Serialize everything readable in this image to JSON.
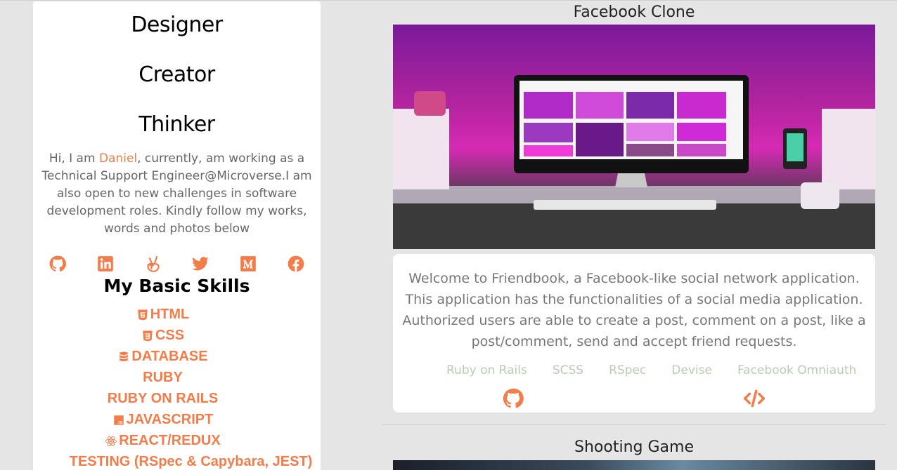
{
  "sidebar": {
    "headlines": [
      "Designer",
      "Creator",
      "Thinker"
    ],
    "bio": {
      "prefix": "Hi, I am ",
      "name": "Daniel",
      "suffix": ", currently, am working as a Technical Support Engineer@Microverse.I am also open to new challenges in software development roles. Kindly follow my works, words and photos below"
    },
    "socials": [
      "github-icon",
      "linkedin-icon",
      "angellist-icon",
      "twitter-icon",
      "medium-icon",
      "facebook-icon"
    ],
    "skills_title": "My Basic Skills",
    "skills": [
      {
        "label": "HTML",
        "icon": "html5-icon"
      },
      {
        "label": "CSS",
        "icon": "css3-icon"
      },
      {
        "label": "DATABASE",
        "icon": "database-icon"
      },
      {
        "label": "RUBY",
        "icon": ""
      },
      {
        "label": "RUBY ON RAILS",
        "icon": ""
      },
      {
        "label": "JAVASCRIPT",
        "icon": "js-icon"
      },
      {
        "label": "REACT/REDUX",
        "icon": "react-icon"
      },
      {
        "label": "TESTING (RSpec & Capybara, JEST)",
        "icon": ""
      }
    ]
  },
  "projects": [
    {
      "title": "Facebook Clone",
      "description": "Welcome to Friendbook, a Facebook-like social network application. This application has the functionalities of a social media application. Authorized users are able to create a post, comment on a post, like a post/comment, send and accept friend requests.",
      "tags": [
        "Ruby on Rails",
        "SCSS",
        "RSpec",
        "Devise",
        "Facebook Omniauth"
      ]
    },
    {
      "title": "Shooting Game"
    }
  ],
  "colors": {
    "accent": "#f47c48",
    "tag": "#b8cdb2",
    "background": "#e5e5e5"
  }
}
